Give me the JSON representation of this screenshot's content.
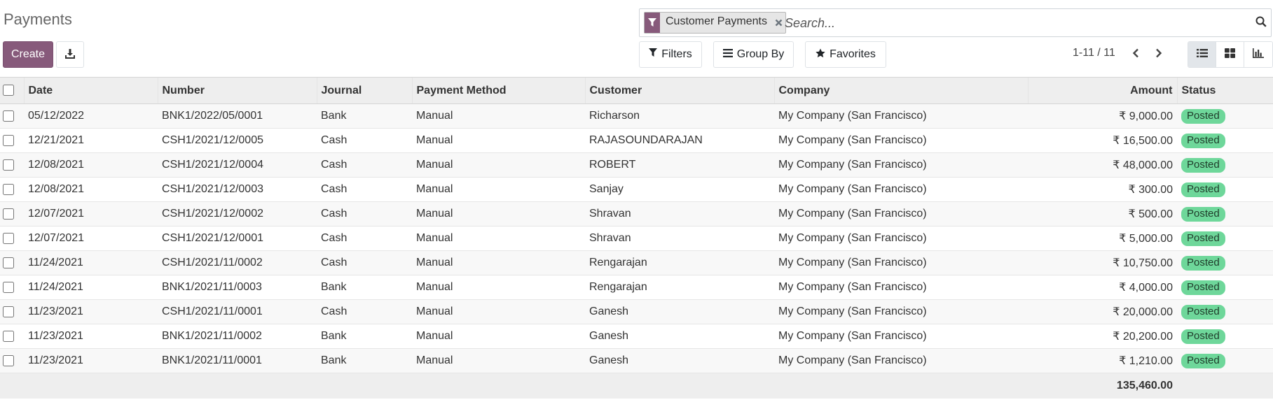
{
  "page": {
    "title": "Payments"
  },
  "toolbar": {
    "create_label": "Create",
    "filters_label": "Filters",
    "group_by_label": "Group By",
    "favorites_label": "Favorites"
  },
  "search": {
    "facet_label": "Customer Payments",
    "placeholder": "Search..."
  },
  "pager": {
    "value": "1-11 / 11"
  },
  "icons": {
    "filter": "filter-icon",
    "download": "download-icon",
    "remove": "close-icon",
    "search": "search-icon",
    "list_view": "list-icon",
    "kanban_view": "grid-icon",
    "graph_view": "bar-chart-icon",
    "favorite": "star-icon",
    "group": "bars-icon"
  },
  "colors": {
    "primary": "#875a7b",
    "posted_badge": "#6ed79a"
  },
  "table": {
    "headers": {
      "date": "Date",
      "number": "Number",
      "journal": "Journal",
      "payment_method": "Payment Method",
      "customer": "Customer",
      "company": "Company",
      "amount": "Amount",
      "status": "Status"
    },
    "rows": [
      {
        "date": "05/12/2022",
        "number": "BNK1/2022/05/0001",
        "journal": "Bank",
        "method": "Manual",
        "customer": "Richarson",
        "company": "My Company (San Francisco)",
        "amount": "₹ 9,000.00",
        "status": "Posted"
      },
      {
        "date": "12/21/2021",
        "number": "CSH1/2021/12/0005",
        "journal": "Cash",
        "method": "Manual",
        "customer": "RAJASOUNDARAJAN",
        "company": "My Company (San Francisco)",
        "amount": "₹ 16,500.00",
        "status": "Posted"
      },
      {
        "date": "12/08/2021",
        "number": "CSH1/2021/12/0004",
        "journal": "Cash",
        "method": "Manual",
        "customer": "ROBERT",
        "company": "My Company (San Francisco)",
        "amount": "₹ 48,000.00",
        "status": "Posted"
      },
      {
        "date": "12/08/2021",
        "number": "CSH1/2021/12/0003",
        "journal": "Cash",
        "method": "Manual",
        "customer": "Sanjay",
        "company": "My Company (San Francisco)",
        "amount": "₹ 300.00",
        "status": "Posted"
      },
      {
        "date": "12/07/2021",
        "number": "CSH1/2021/12/0002",
        "journal": "Cash",
        "method": "Manual",
        "customer": "Shravan",
        "company": "My Company (San Francisco)",
        "amount": "₹ 500.00",
        "status": "Posted"
      },
      {
        "date": "12/07/2021",
        "number": "CSH1/2021/12/0001",
        "journal": "Cash",
        "method": "Manual",
        "customer": "Shravan",
        "company": "My Company (San Francisco)",
        "amount": "₹ 5,000.00",
        "status": "Posted"
      },
      {
        "date": "11/24/2021",
        "number": "CSH1/2021/11/0002",
        "journal": "Cash",
        "method": "Manual",
        "customer": "Rengarajan",
        "company": "My Company (San Francisco)",
        "amount": "₹ 10,750.00",
        "status": "Posted"
      },
      {
        "date": "11/24/2021",
        "number": "BNK1/2021/11/0003",
        "journal": "Bank",
        "method": "Manual",
        "customer": "Rengarajan",
        "company": "My Company (San Francisco)",
        "amount": "₹ 4,000.00",
        "status": "Posted"
      },
      {
        "date": "11/23/2021",
        "number": "CSH1/2021/11/0001",
        "journal": "Cash",
        "method": "Manual",
        "customer": "Ganesh",
        "company": "My Company (San Francisco)",
        "amount": "₹ 20,000.00",
        "status": "Posted"
      },
      {
        "date": "11/23/2021",
        "number": "BNK1/2021/11/0002",
        "journal": "Bank",
        "method": "Manual",
        "customer": "Ganesh",
        "company": "My Company (San Francisco)",
        "amount": "₹ 20,200.00",
        "status": "Posted"
      },
      {
        "date": "11/23/2021",
        "number": "BNK1/2021/11/0001",
        "journal": "Bank",
        "method": "Manual",
        "customer": "Ganesh",
        "company": "My Company (San Francisco)",
        "amount": "₹ 1,210.00",
        "status": "Posted"
      }
    ],
    "total_amount": "135,460.00"
  }
}
